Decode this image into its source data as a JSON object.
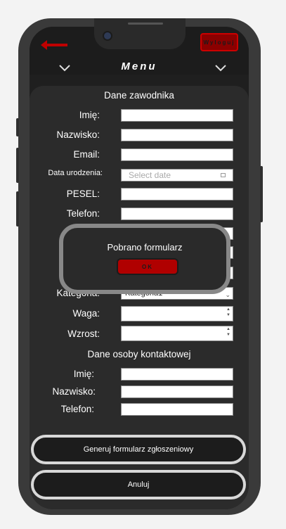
{
  "header": {
    "menu_title": "Menu",
    "logout_label": "Wyloguj"
  },
  "athlete": {
    "section_title": "Dane zawodnika",
    "imie_label": "Imię:",
    "nazwisko_label": "Nazwisko:",
    "email_label": "Email:",
    "birthdate_label": "Data urodzenia:",
    "birthdate_placeholder": "Select date",
    "pesel_label": "PESEL:",
    "telefon_label": "Telefon:",
    "kategoria_label": "Kategoria:",
    "kategoria_value": "Kategoria1",
    "waga_label": "Waga:",
    "wzrost_label": "Wzrost:"
  },
  "contact": {
    "section_title": "Dane osoby kontaktowej",
    "imie_label": "Imię:",
    "nazwisko_label": "Nazwisko:",
    "telefon_label": "Telefon:"
  },
  "dialog": {
    "message": "Pobrano formularz",
    "ok_label": "OK"
  },
  "actions": {
    "generate_label": "Generuj formularz zgłoszeniowy",
    "cancel_label": "Anuluj"
  },
  "icons": {
    "back": "back-arrow-icon",
    "chevron": "chevron-down-icon",
    "calendar": "calendar-icon"
  },
  "colors": {
    "accent_red": "#b00000",
    "panel": "#2b2b2b",
    "frame": "#3a3a3a"
  }
}
